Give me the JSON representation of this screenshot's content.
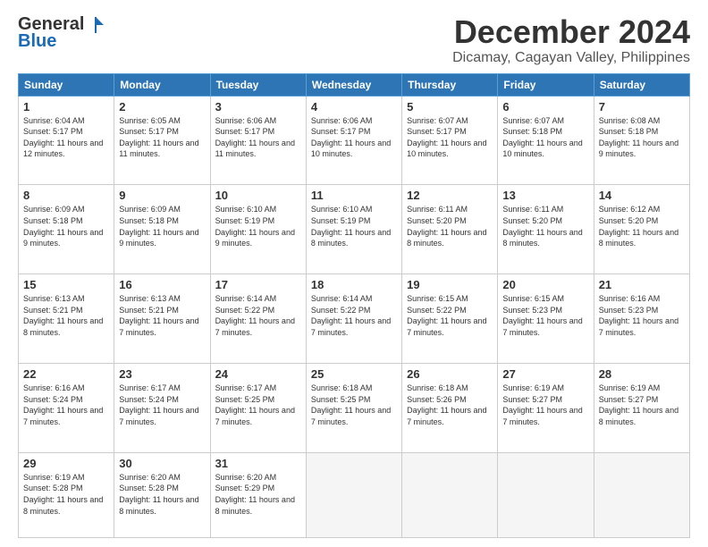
{
  "logo": {
    "general": "General",
    "blue": "Blue"
  },
  "title": "December 2024",
  "location": "Dicamay, Cagayan Valley, Philippines",
  "weekdays": [
    "Sunday",
    "Monday",
    "Tuesday",
    "Wednesday",
    "Thursday",
    "Friday",
    "Saturday"
  ],
  "weeks": [
    [
      {
        "day": "1",
        "sunrise": "6:04 AM",
        "sunset": "5:17 PM",
        "daylight": "11 hours and 12 minutes."
      },
      {
        "day": "2",
        "sunrise": "6:05 AM",
        "sunset": "5:17 PM",
        "daylight": "11 hours and 11 minutes."
      },
      {
        "day": "3",
        "sunrise": "6:06 AM",
        "sunset": "5:17 PM",
        "daylight": "11 hours and 11 minutes."
      },
      {
        "day": "4",
        "sunrise": "6:06 AM",
        "sunset": "5:17 PM",
        "daylight": "11 hours and 10 minutes."
      },
      {
        "day": "5",
        "sunrise": "6:07 AM",
        "sunset": "5:17 PM",
        "daylight": "11 hours and 10 minutes."
      },
      {
        "day": "6",
        "sunrise": "6:07 AM",
        "sunset": "5:18 PM",
        "daylight": "11 hours and 10 minutes."
      },
      {
        "day": "7",
        "sunrise": "6:08 AM",
        "sunset": "5:18 PM",
        "daylight": "11 hours and 9 minutes."
      }
    ],
    [
      {
        "day": "8",
        "sunrise": "6:09 AM",
        "sunset": "5:18 PM",
        "daylight": "11 hours and 9 minutes."
      },
      {
        "day": "9",
        "sunrise": "6:09 AM",
        "sunset": "5:18 PM",
        "daylight": "11 hours and 9 minutes."
      },
      {
        "day": "10",
        "sunrise": "6:10 AM",
        "sunset": "5:19 PM",
        "daylight": "11 hours and 9 minutes."
      },
      {
        "day": "11",
        "sunrise": "6:10 AM",
        "sunset": "5:19 PM",
        "daylight": "11 hours and 8 minutes."
      },
      {
        "day": "12",
        "sunrise": "6:11 AM",
        "sunset": "5:20 PM",
        "daylight": "11 hours and 8 minutes."
      },
      {
        "day": "13",
        "sunrise": "6:11 AM",
        "sunset": "5:20 PM",
        "daylight": "11 hours and 8 minutes."
      },
      {
        "day": "14",
        "sunrise": "6:12 AM",
        "sunset": "5:20 PM",
        "daylight": "11 hours and 8 minutes."
      }
    ],
    [
      {
        "day": "15",
        "sunrise": "6:13 AM",
        "sunset": "5:21 PM",
        "daylight": "11 hours and 8 minutes."
      },
      {
        "day": "16",
        "sunrise": "6:13 AM",
        "sunset": "5:21 PM",
        "daylight": "11 hours and 7 minutes."
      },
      {
        "day": "17",
        "sunrise": "6:14 AM",
        "sunset": "5:22 PM",
        "daylight": "11 hours and 7 minutes."
      },
      {
        "day": "18",
        "sunrise": "6:14 AM",
        "sunset": "5:22 PM",
        "daylight": "11 hours and 7 minutes."
      },
      {
        "day": "19",
        "sunrise": "6:15 AM",
        "sunset": "5:22 PM",
        "daylight": "11 hours and 7 minutes."
      },
      {
        "day": "20",
        "sunrise": "6:15 AM",
        "sunset": "5:23 PM",
        "daylight": "11 hours and 7 minutes."
      },
      {
        "day": "21",
        "sunrise": "6:16 AM",
        "sunset": "5:23 PM",
        "daylight": "11 hours and 7 minutes."
      }
    ],
    [
      {
        "day": "22",
        "sunrise": "6:16 AM",
        "sunset": "5:24 PM",
        "daylight": "11 hours and 7 minutes."
      },
      {
        "day": "23",
        "sunrise": "6:17 AM",
        "sunset": "5:24 PM",
        "daylight": "11 hours and 7 minutes."
      },
      {
        "day": "24",
        "sunrise": "6:17 AM",
        "sunset": "5:25 PM",
        "daylight": "11 hours and 7 minutes."
      },
      {
        "day": "25",
        "sunrise": "6:18 AM",
        "sunset": "5:25 PM",
        "daylight": "11 hours and 7 minutes."
      },
      {
        "day": "26",
        "sunrise": "6:18 AM",
        "sunset": "5:26 PM",
        "daylight": "11 hours and 7 minutes."
      },
      {
        "day": "27",
        "sunrise": "6:19 AM",
        "sunset": "5:27 PM",
        "daylight": "11 hours and 7 minutes."
      },
      {
        "day": "28",
        "sunrise": "6:19 AM",
        "sunset": "5:27 PM",
        "daylight": "11 hours and 8 minutes."
      }
    ],
    [
      {
        "day": "29",
        "sunrise": "6:19 AM",
        "sunset": "5:28 PM",
        "daylight": "11 hours and 8 minutes."
      },
      {
        "day": "30",
        "sunrise": "6:20 AM",
        "sunset": "5:28 PM",
        "daylight": "11 hours and 8 minutes."
      },
      {
        "day": "31",
        "sunrise": "6:20 AM",
        "sunset": "5:29 PM",
        "daylight": "11 hours and 8 minutes."
      },
      null,
      null,
      null,
      null
    ]
  ]
}
